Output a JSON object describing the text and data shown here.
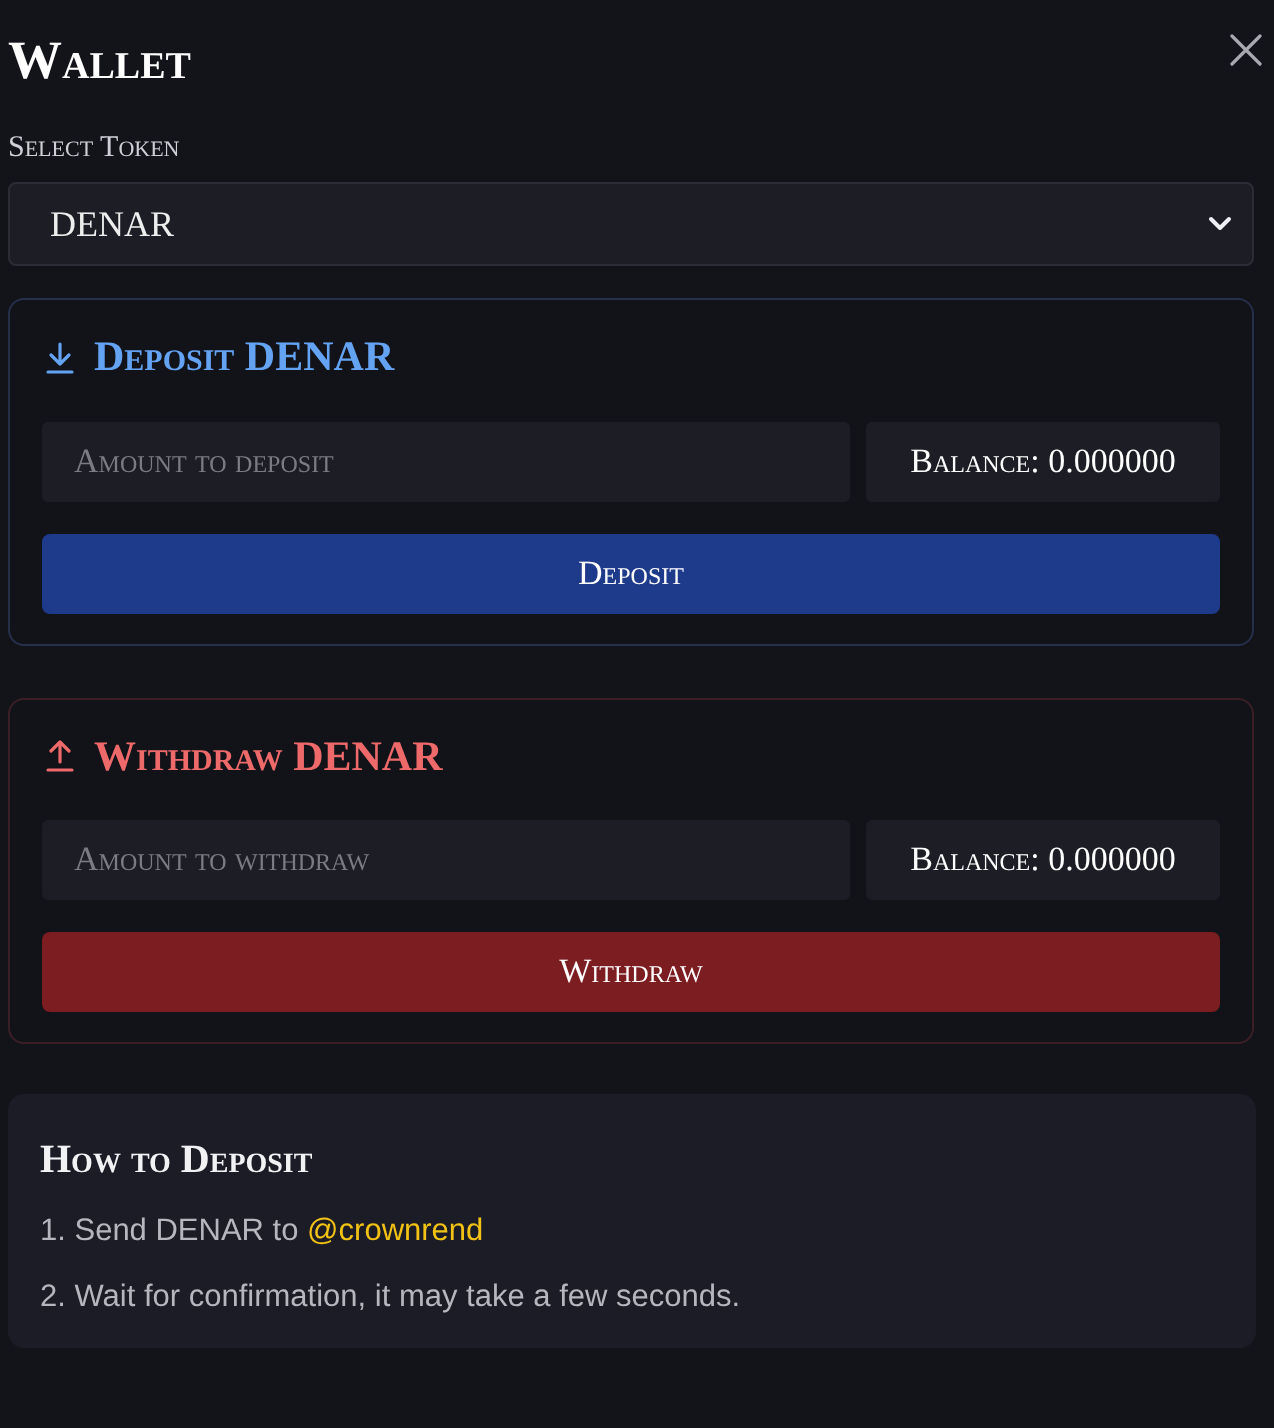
{
  "dialog": {
    "title": "Wallet"
  },
  "token_select": {
    "label": "Select Token",
    "value": "DENAR"
  },
  "panels": [
    {
      "kind": "deposit",
      "title": "Deposit DENAR",
      "placeholder": "Amount to deposit",
      "balance": "Balance: 0.000000",
      "button": "Deposit"
    },
    {
      "kind": "withdraw",
      "title": "Withdraw DENAR",
      "placeholder": "Amount to withdraw",
      "balance": "Balance: 0.000000",
      "button": "Withdraw"
    }
  ],
  "instructions": {
    "title": "How to Deposit",
    "steps": [
      {
        "text": "1. Send DENAR to",
        "handle": "@crownrend"
      },
      {
        "text": "2. Wait for confirmation, it may take a few seconds."
      }
    ]
  }
}
